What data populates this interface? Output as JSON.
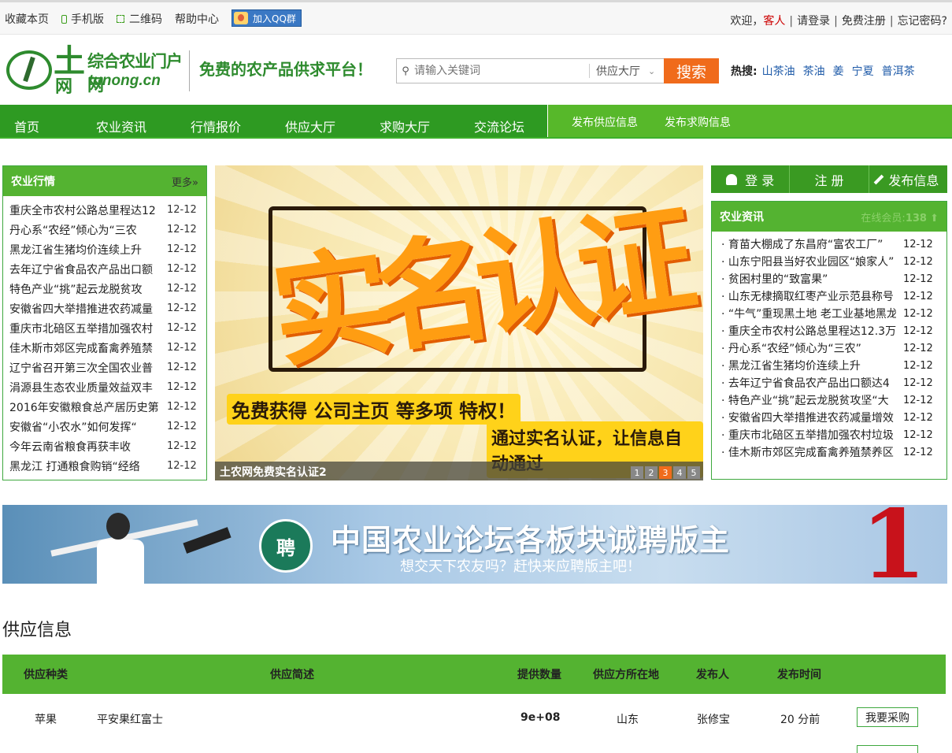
{
  "topbar": {
    "bookmark": "收藏本页",
    "mobile": "手机版",
    "qrcode": "二维码",
    "help": "帮助中心",
    "qq_group": "加入QQ群",
    "welcome": "欢迎，",
    "guest": "客人",
    "login": "请登录",
    "register": "免费注册",
    "forgot": "忘记密码?"
  },
  "header": {
    "logo_char": "土",
    "logo_char2": "网",
    "logo_name": "综合农业门户网",
    "logo_domain": "tunong.cn",
    "slogan": "免费的农产品供求平台！",
    "search_placeholder": "请输入关键词",
    "search_scope": "供应大厅",
    "search_button": "搜索",
    "hot_label": "热搜:",
    "hot_terms": [
      "山茶油",
      "茶油",
      "姜",
      "宁夏",
      "普洱茶"
    ]
  },
  "nav": {
    "items": [
      "首页",
      "农业资讯",
      "行情报价",
      "供应大厅",
      "求购大厅",
      "交流论坛"
    ],
    "sub": [
      "发布供应信息",
      "发布求购信息"
    ]
  },
  "market": {
    "title": "农业行情",
    "more": "更多»",
    "items": [
      {
        "t": "重庆全市农村公路总里程达12",
        "d": "12-12"
      },
      {
        "t": "丹心系“农经”倾心为“三农",
        "d": "12-12"
      },
      {
        "t": "黑龙江省生猪均价连续上升",
        "d": "12-12"
      },
      {
        "t": "去年辽宁省食品农产品出口额",
        "d": "12-12"
      },
      {
        "t": "特色产业“挑”起云龙脱贫攻",
        "d": "12-12"
      },
      {
        "t": "安徽省四大举措推进农药减量",
        "d": "12-12"
      },
      {
        "t": "重庆市北碚区五举措加强农村",
        "d": "12-12"
      },
      {
        "t": "佳木斯市郊区完成畜禽养殖禁",
        "d": "12-12"
      },
      {
        "t": "辽宁省召开第三次全国农业普",
        "d": "12-12"
      },
      {
        "t": "涓源县生态农业质量效益双丰",
        "d": "12-12"
      },
      {
        "t": "2016年安徽粮食总产居历史第",
        "d": "12-12"
      },
      {
        "t": "安徽省“小农水”如何发挥“",
        "d": "12-12"
      },
      {
        "t": "今年云南省粮食再获丰收",
        "d": "12-12"
      },
      {
        "t": "黑龙江 打通粮食购销“经络",
        "d": "12-12"
      }
    ]
  },
  "slider": {
    "headline": "实名认证",
    "tag1": "免费获得 公司主页 等多项 特权！",
    "tag2": "通过实名认证，让信息自动通过",
    "caption": "土农网免费实名认证2",
    "pages": [
      "1",
      "2",
      "3",
      "4",
      "5"
    ],
    "active_page": "3"
  },
  "account": {
    "login": "登 录",
    "register": "注 册",
    "post": "发布信息"
  },
  "agnews": {
    "title": "农业资讯",
    "online_label": "在线会员:",
    "online_count": "138",
    "items": [
      {
        "t": "· 育苗大棚成了东昌府“富农工厂”",
        "d": "12-12"
      },
      {
        "t": "· 山东宁阳县当好农业园区“娘家人”",
        "d": "12-12"
      },
      {
        "t": "· 贫困村里的“致富果”",
        "d": "12-12"
      },
      {
        "t": "· 山东无棣摘取红枣产业示范县称号",
        "d": "12-12"
      },
      {
        "t": "· “牛气”重现黑土地 老工业基地黑龙",
        "d": "12-12"
      },
      {
        "t": "· 重庆全市农村公路总里程达12.3万",
        "d": "12-12"
      },
      {
        "t": "· 丹心系“农经”倾心为“三农”",
        "d": "12-12"
      },
      {
        "t": "· 黑龙江省生猪均价连续上升",
        "d": "12-12"
      },
      {
        "t": "· 去年辽宁省食品农产品出口额达4",
        "d": "12-12"
      },
      {
        "t": "· 特色产业“挑”起云龙脱贫攻坚“大",
        "d": "12-12"
      },
      {
        "t": "· 安徽省四大举措推进农药减量增效",
        "d": "12-12"
      },
      {
        "t": "· 重庆市北碚区五举措加强农村垃圾",
        "d": "12-12"
      },
      {
        "t": "· 佳木斯市郊区完成畜禽养殖禁养区",
        "d": "12-12"
      }
    ]
  },
  "ad": {
    "badge": "聘",
    "headline": "中国农业论坛各板块诚聘版主",
    "sub": "想交天下农友吗？赶快来应聘版主吧！",
    "number": "1"
  },
  "supply": {
    "title": "供应信息",
    "headers": [
      "供应种类",
      "供应简述",
      "提供数量",
      "供应方所在地",
      "发布人",
      "发布时间"
    ],
    "rows": [
      {
        "kind": "苹果",
        "desc": "平安果红富士",
        "qty": "9e+08",
        "loc": "山东",
        "user": "张修宝",
        "time": "20 分前",
        "action": "我要采购"
      }
    ]
  },
  "colors": {
    "primary_green": "#2e9a22",
    "accent_orange": "#f06b1b",
    "guest_red": "#cc0000"
  }
}
